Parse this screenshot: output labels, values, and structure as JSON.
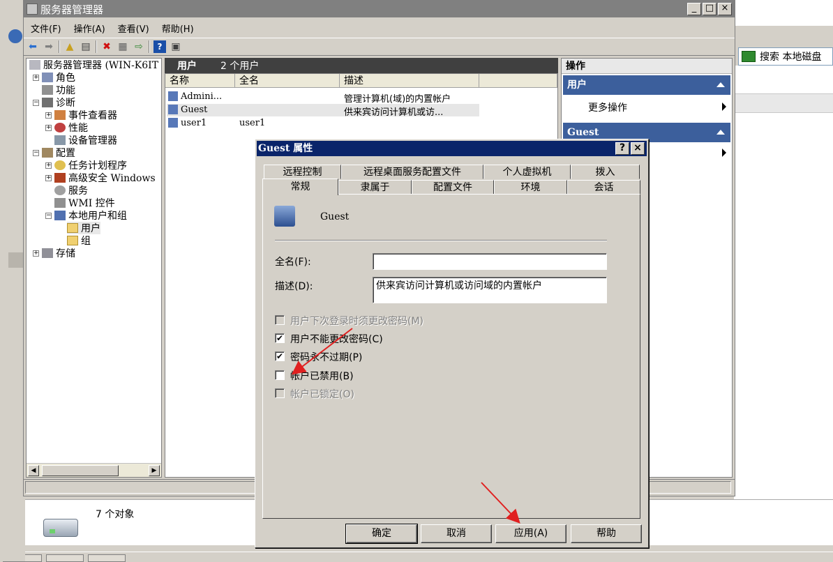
{
  "background": {
    "search_label": "搜索 本地磁盘"
  },
  "window": {
    "title": "服务器管理器",
    "controls": {
      "minimize": "_",
      "maximize": "□",
      "close": "×"
    }
  },
  "menu": {
    "file": "文件(F)",
    "action": "操作(A)",
    "view": "查看(V)",
    "help": "帮助(H)"
  },
  "tree": {
    "root": "服务器管理器 (WIN-K6IT",
    "roles": "角色",
    "features": "功能",
    "diagnostics": "诊断",
    "event_viewer": "事件查看器",
    "performance": "性能",
    "device_manager": "设备管理器",
    "configuration": "配置",
    "task_scheduler": "任务计划程序",
    "firewall": "高级安全 Windows",
    "services": "服务",
    "wmi": "WMI 控件",
    "local_users": "本地用户和组",
    "users": "用户",
    "groups": "组",
    "storage": "存储"
  },
  "list": {
    "header_title": "用户",
    "header_count": "2 个用户",
    "columns": [
      "名称",
      "全名",
      "描述"
    ],
    "rows": [
      {
        "name": "Admini...",
        "fullname": "",
        "desc": "管理计算机(域)的内置帐户"
      },
      {
        "name": "Guest",
        "fullname": "",
        "desc": "供来宾访问计算机或访..."
      },
      {
        "name": "user1",
        "fullname": "user1",
        "desc": ""
      }
    ]
  },
  "actions": {
    "header": "操作",
    "section1": "用户",
    "more_actions": "更多操作",
    "section2": "Guest"
  },
  "status": {
    "object_count": "7 个对象"
  },
  "dialog": {
    "title": "Guest 属性",
    "help_btn": "?",
    "close_btn": "×",
    "tabs_row1": [
      "远程控制",
      "远程桌面服务配置文件",
      "个人虚拟机",
      "拨入"
    ],
    "tabs_row2": [
      "常规",
      "隶属于",
      "配置文件",
      "环境",
      "会话"
    ],
    "active_tab": "常规",
    "username": "Guest",
    "fullname_label": "全名(F):",
    "fullname_value": "",
    "desc_label": "描述(D):",
    "desc_value": "供来宾访问计算机或访问域的内置帐户",
    "checkboxes": [
      {
        "label": "用户下次登录时须更改密码(M)",
        "checked": false,
        "disabled": true
      },
      {
        "label": "用户不能更改密码(C)",
        "checked": true,
        "disabled": false
      },
      {
        "label": "密码永不过期(P)",
        "checked": true,
        "disabled": false
      },
      {
        "label": "帐户已禁用(B)",
        "checked": false,
        "disabled": false
      },
      {
        "label": "帐户已锁定(O)",
        "checked": false,
        "disabled": true
      }
    ],
    "buttons": {
      "ok": "确定",
      "cancel": "取消",
      "apply": "应用(A)",
      "help": "帮助"
    }
  },
  "colors": {
    "dialog_title_bg": "#0a246a",
    "action_section_bg": "#3c5f9c",
    "annotation_arrow": "#e02020"
  }
}
